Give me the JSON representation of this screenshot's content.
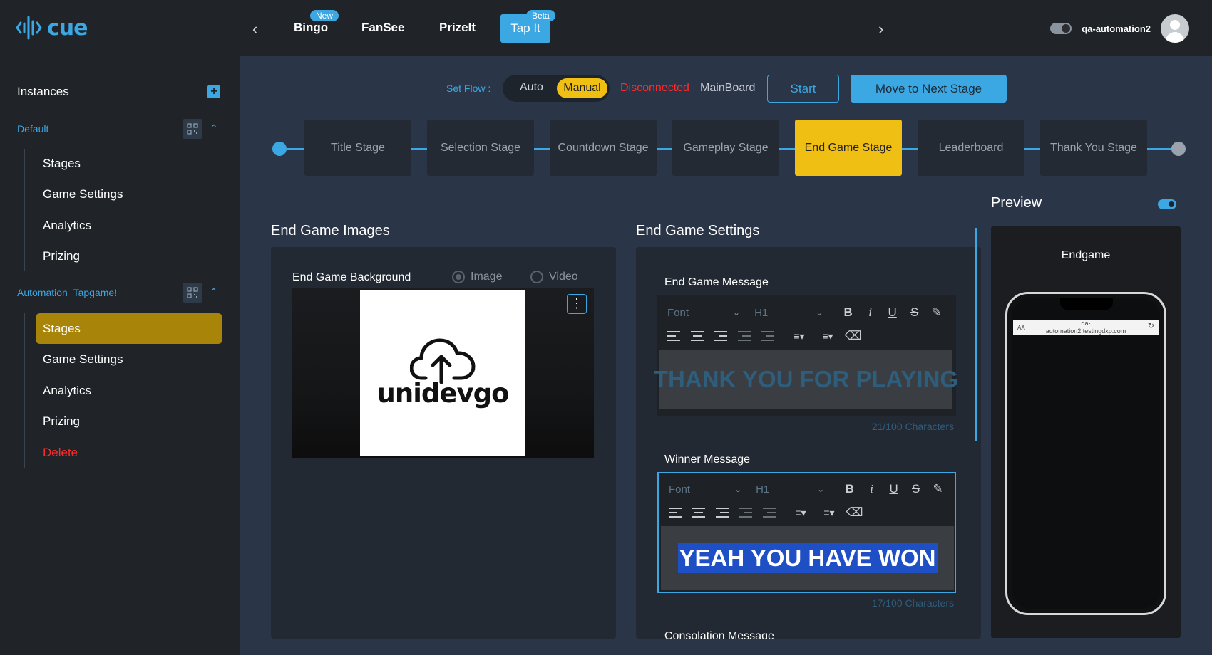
{
  "header": {
    "logo_text": "cue",
    "tabs": [
      {
        "label": "Bingo",
        "badge": "New"
      },
      {
        "label": "FanSee"
      },
      {
        "label": "PrizeIt"
      },
      {
        "label": "Tap It",
        "badge": "Beta",
        "active": true
      }
    ],
    "username": "qa-automation2"
  },
  "sidebar": {
    "title": "Instances",
    "groups": [
      {
        "label": "Default",
        "items": [
          "Stages",
          "Game Settings",
          "Analytics",
          "Prizing"
        ]
      },
      {
        "label": "Automation_Tapgame!",
        "items": [
          "Stages",
          "Game Settings",
          "Analytics",
          "Prizing",
          "Delete"
        ],
        "active_item": "Stages"
      }
    ]
  },
  "flow": {
    "label": "Set Flow :",
    "auto": "Auto",
    "manual": "Manual",
    "status": "Disconnected",
    "board": "MainBoard",
    "start_button": "Start",
    "next_button": "Move to Next Stage"
  },
  "stages": [
    "Title Stage",
    "Selection Stage",
    "Countdown Stage",
    "Gameplay Stage",
    "End Game Stage",
    "Leaderboard",
    "Thank You Stage"
  ],
  "active_stage": "End Game Stage",
  "images_section": {
    "title": "End Game Images",
    "field_label": "End Game Background",
    "radio_image": "Image",
    "radio_video": "Video",
    "logo_text": "unidevgo"
  },
  "settings_section": {
    "title": "End Game Settings",
    "end_message": {
      "label": "End Game Message",
      "text": "THANK YOU FOR PLAYING",
      "counter": "21/100 Characters"
    },
    "winner_message": {
      "label": "Winner Message",
      "text": "YEAH YOU HAVE WON",
      "counter": "17/100 Characters"
    },
    "consolation_label": "Consolation Message",
    "toolbar": {
      "font": "Font",
      "heading": "H1"
    }
  },
  "preview": {
    "title": "Preview",
    "screen_label": "Endgame",
    "url_line1": "qa-",
    "url_line2": "automation2.testingdxp.com",
    "url_aa": "AA"
  },
  "colors": {
    "accent": "#3ba7e3",
    "active_stage": "#f0bf13",
    "active_sidebar": "#a88408",
    "danger": "#ff2a2a"
  }
}
